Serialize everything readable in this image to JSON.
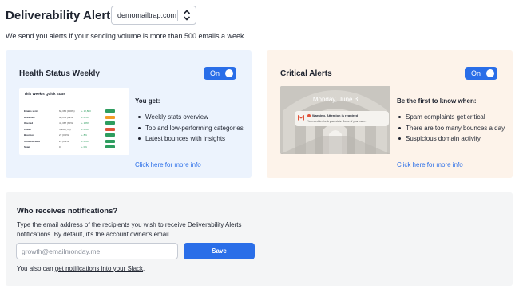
{
  "header": {
    "title": "Deliverability Alerts",
    "domain_select": {
      "selected": "demomailtrap.com"
    },
    "subtitle": "We send you alerts if your sending volume is more than 500 emails a week."
  },
  "health_card": {
    "title": "Health Status Weekly",
    "toggle_label": "On",
    "toggle_on": true,
    "body_title": "You get:",
    "bullets": [
      "Weekly stats overview",
      "Top and low-performing categories",
      "Latest bounces with insights"
    ],
    "more_link": "Click here for more info",
    "preview": {
      "title": "This Week's Quick Stats",
      "rows": [
        {
          "label": "Emails sent",
          "value": "68,360 (100%)",
          "change": "+ 12,880",
          "status": "ok"
        },
        {
          "label": "Delivered",
          "value": "68,170 (99%)",
          "change": "+ 0.5%",
          "status": "warn"
        },
        {
          "label": "Opened",
          "value": "41,367 (60%)",
          "change": "+ 1.8%",
          "status": "ok"
        },
        {
          "label": "Clicks",
          "value": "5,396 (7%)",
          "change": "+ 0.9%",
          "status": "bad"
        },
        {
          "label": "Bounces",
          "value": "27 (0.0%)",
          "change": "+ 8%",
          "status": "ok"
        },
        {
          "label": "Unsubscribed",
          "value": "23 (0.1%)",
          "change": "+ 0.9%",
          "status": "ok"
        },
        {
          "label": "Spam",
          "value": "0",
          "change": "+ 0%",
          "status": "ok"
        }
      ]
    }
  },
  "critical_card": {
    "title": "Critical Alerts",
    "toggle_label": "On",
    "toggle_on": true,
    "body_title": "Be the first to know when:",
    "bullets": [
      "Spam complaints get critical",
      "There are too many bounces a day",
      "Suspicious domain activity"
    ],
    "more_link": "Click here for more info",
    "preview": {
      "date": "Monday, June 3",
      "notification_title": "Warning. Attention is required",
      "notification_text": "You need to check your stats. Some of your main..."
    }
  },
  "notifications": {
    "title": "Who receives notifications?",
    "description": "Type the email address of the recipients you wish to receive Deliverability Alerts notifications. By default, it's the account owner's email.",
    "email_placeholder": "growth@emailmonday.me",
    "save_label": "Save",
    "slack_prefix": "You also can ",
    "slack_link": "get notifications into your Slack",
    "slack_suffix": "."
  },
  "colors": {
    "accent": "#2a6ee8",
    "health_bg": "#ecf3fd",
    "critical_bg": "#fdf3ea",
    "section_bg": "#f4f5f6"
  }
}
